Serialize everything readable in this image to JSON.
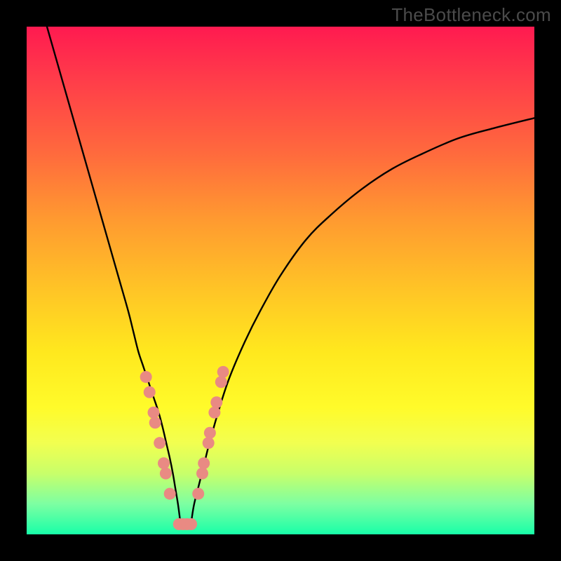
{
  "watermark": "TheBottleneck.com",
  "chart_data": {
    "type": "line",
    "title": "",
    "xlabel": "",
    "ylabel": "",
    "xlim": [
      0,
      100
    ],
    "ylim": [
      0,
      100
    ],
    "grid": false,
    "series": [
      {
        "name": "left-branch",
        "x": [
          4,
          6,
          8,
          10,
          12,
          14,
          16,
          18,
          20,
          21,
          22,
          23,
          24,
          25,
          26,
          26.8,
          27.5,
          28.2,
          28.8,
          29.3,
          29.8,
          30.2
        ],
        "y": [
          100,
          93,
          86,
          79,
          72,
          65,
          58,
          51,
          44,
          40,
          36,
          33,
          30,
          27,
          24,
          21,
          18,
          15,
          12,
          9,
          6,
          3
        ]
      },
      {
        "name": "right-branch",
        "x": [
          32.5,
          33,
          34,
          35,
          36,
          38,
          40,
          43,
          46,
          50,
          55,
          60,
          66,
          72,
          78,
          85,
          92,
          100
        ],
        "y": [
          3,
          6,
          10,
          14,
          18,
          25,
          31,
          38,
          44,
          51,
          58,
          63,
          68,
          72,
          75,
          78,
          80,
          82
        ]
      },
      {
        "name": "dot-markers-left",
        "x": [
          23.5,
          24.2,
          25.0,
          25.3,
          26.2,
          27.0,
          27.4,
          28.2
        ],
        "y": [
          31,
          28,
          24,
          22,
          18,
          14,
          12,
          8
        ]
      },
      {
        "name": "dot-markers-right",
        "x": [
          33.8,
          34.6,
          34.9,
          35.8,
          36.1,
          37.0,
          37.4,
          38.3,
          38.7
        ],
        "y": [
          8,
          12,
          14,
          18,
          20,
          24,
          26,
          30,
          32
        ]
      },
      {
        "name": "dot-markers-bottom",
        "x": [
          30.0,
          30.8,
          31.6,
          32.4
        ],
        "y": [
          2,
          2,
          2,
          2
        ]
      }
    ],
    "colors": {
      "curve": "#000000",
      "dots": "#e98a83"
    }
  }
}
